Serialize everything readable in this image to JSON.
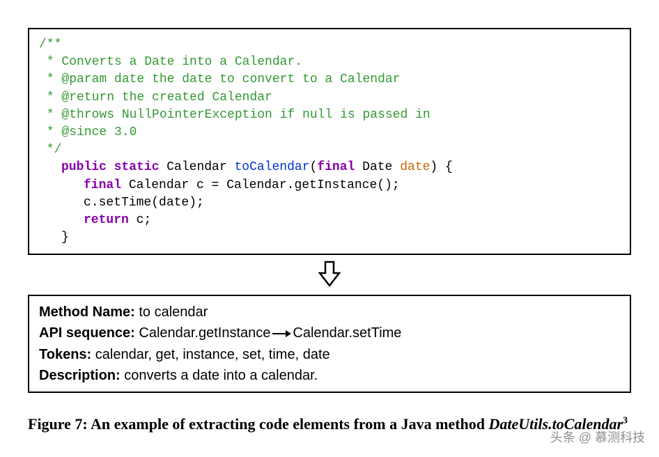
{
  "code": {
    "c1": "/**",
    "c2": " * Converts a Date into a Calendar.",
    "c3": " * @param date the date to convert to a Calendar",
    "c4": " * @return the created Calendar",
    "c5": " * @throws NullPointerException if null is passed in",
    "c6": " * @since 3.0",
    "c7": " */",
    "kw_public": "public",
    "kw_static": "static",
    "type_cal": "Calendar",
    "method_name": "toCalendar",
    "paren_open": "(",
    "kw_final": "final",
    "type_date": "Date",
    "param_date": "date",
    "paren_close_brace": ") {",
    "line_body1_a": "final",
    "line_body1_b": " Calendar c = Calendar.getInstance();",
    "line_body2": "c.setTime(date);",
    "kw_return": "return",
    "return_tail": " c;",
    "close_brace": "}"
  },
  "info": {
    "label_method": "Method Name:",
    "val_method": " to calendar",
    "label_api": "API sequence:",
    "api1": " Calendar.getInstance",
    "api2": "Calendar.setTime",
    "label_tokens": "Tokens:",
    "val_tokens": " calendar, get, instance, set, time, date",
    "label_desc": "Description:",
    "val_desc": "  converts a date into a calendar."
  },
  "caption": {
    "prefix": "Figure 7: An example of extracting code elements from a Java method ",
    "italic": "DateUtils.toCalendar",
    "sup": "3"
  },
  "watermark": "头条 @ 慕测科技"
}
